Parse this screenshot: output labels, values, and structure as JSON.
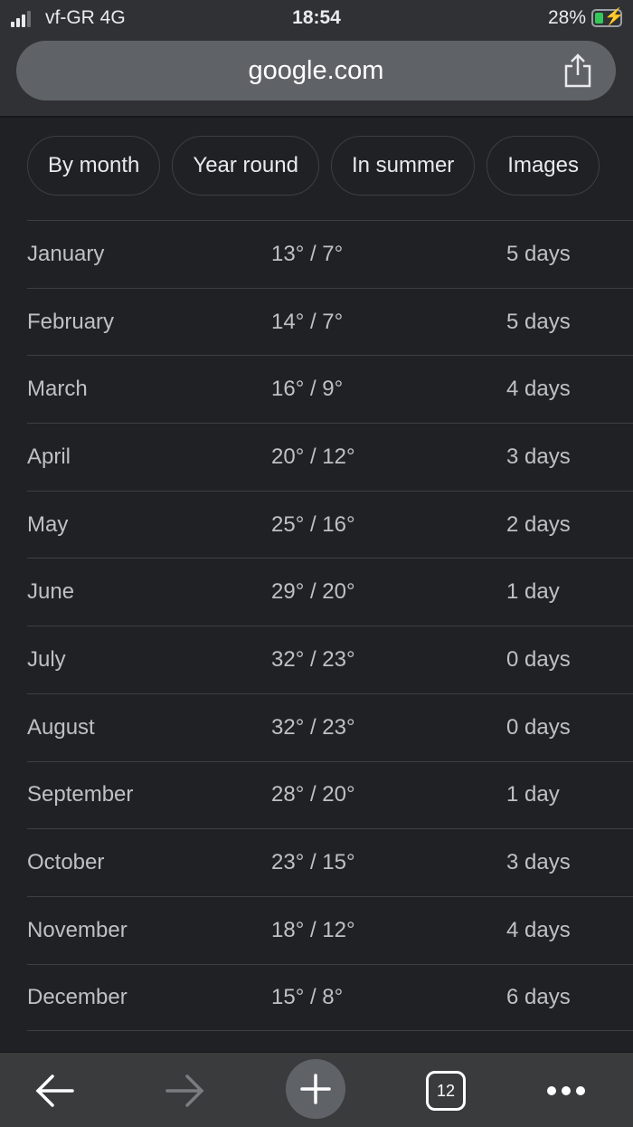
{
  "status_bar": {
    "carrier": "vf-GR  4G",
    "time": "18:54",
    "battery": "28%",
    "battery_level_percent": 28,
    "charging": true
  },
  "address_bar": {
    "url": "google.com",
    "share_icon": "share-icon"
  },
  "chips": [
    {
      "label": "By month"
    },
    {
      "label": "Year round"
    },
    {
      "label": "In summer"
    },
    {
      "label": "Images"
    }
  ],
  "months": [
    {
      "month": "January",
      "temp": "13° / 7°",
      "rain": "5 days"
    },
    {
      "month": "February",
      "temp": "14° / 7°",
      "rain": "5 days"
    },
    {
      "month": "March",
      "temp": "16° / 9°",
      "rain": "4 days"
    },
    {
      "month": "April",
      "temp": "20° / 12°",
      "rain": "3 days"
    },
    {
      "month": "May",
      "temp": "25° / 16°",
      "rain": "2 days"
    },
    {
      "month": "June",
      "temp": "29° / 20°",
      "rain": "1 day"
    },
    {
      "month": "July",
      "temp": "32° / 23°",
      "rain": "0 days"
    },
    {
      "month": "August",
      "temp": "32° / 23°",
      "rain": "0 days"
    },
    {
      "month": "September",
      "temp": "28° / 20°",
      "rain": "1 day"
    },
    {
      "month": "October",
      "temp": "23° / 15°",
      "rain": "3 days"
    },
    {
      "month": "November",
      "temp": "18° / 12°",
      "rain": "4 days"
    },
    {
      "month": "December",
      "temp": "15° / 8°",
      "rain": "6 days"
    }
  ],
  "toolbar": {
    "tab_count": "12"
  }
}
